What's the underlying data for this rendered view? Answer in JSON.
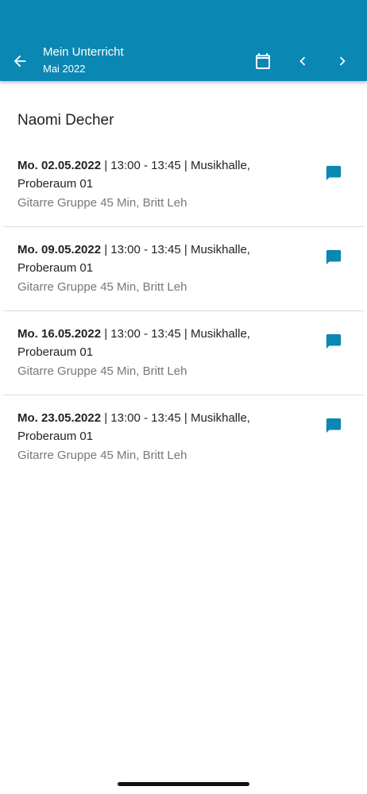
{
  "colors": {
    "primary": "#0b87b3",
    "icon_accent": "#0b87b3",
    "text_primary": "#222222",
    "text_secondary": "#777777"
  },
  "appbar": {
    "title": "Mein Unterricht",
    "subtitle": "Mai 2022",
    "icons": {
      "back": "arrow-left-icon",
      "calendar": "calendar-icon",
      "prev": "chevron-left-icon",
      "next": "chevron-right-icon"
    }
  },
  "student_name": "Naomi Decher",
  "lessons": [
    {
      "date": "Mo. 02.05.2022",
      "details": " | 13:00 - 13:45 | Musikhalle, Proberaum 01",
      "subtitle": "Gitarre Gruppe 45 Min, Britt Leh",
      "icon": "comment-icon"
    },
    {
      "date": "Mo. 09.05.2022",
      "details": " | 13:00 - 13:45 | Musikhalle, Proberaum 01",
      "subtitle": "Gitarre Gruppe 45 Min, Britt Leh",
      "icon": "comment-icon"
    },
    {
      "date": "Mo. 16.05.2022",
      "details": " | 13:00 - 13:45 | Musikhalle, Proberaum 01",
      "subtitle": "Gitarre Gruppe 45 Min, Britt Leh",
      "icon": "comment-icon"
    },
    {
      "date": "Mo. 23.05.2022",
      "details": " | 13:00 - 13:45 | Musikhalle, Proberaum 01",
      "subtitle": "Gitarre Gruppe 45 Min, Britt Leh",
      "icon": "comment-icon"
    }
  ]
}
